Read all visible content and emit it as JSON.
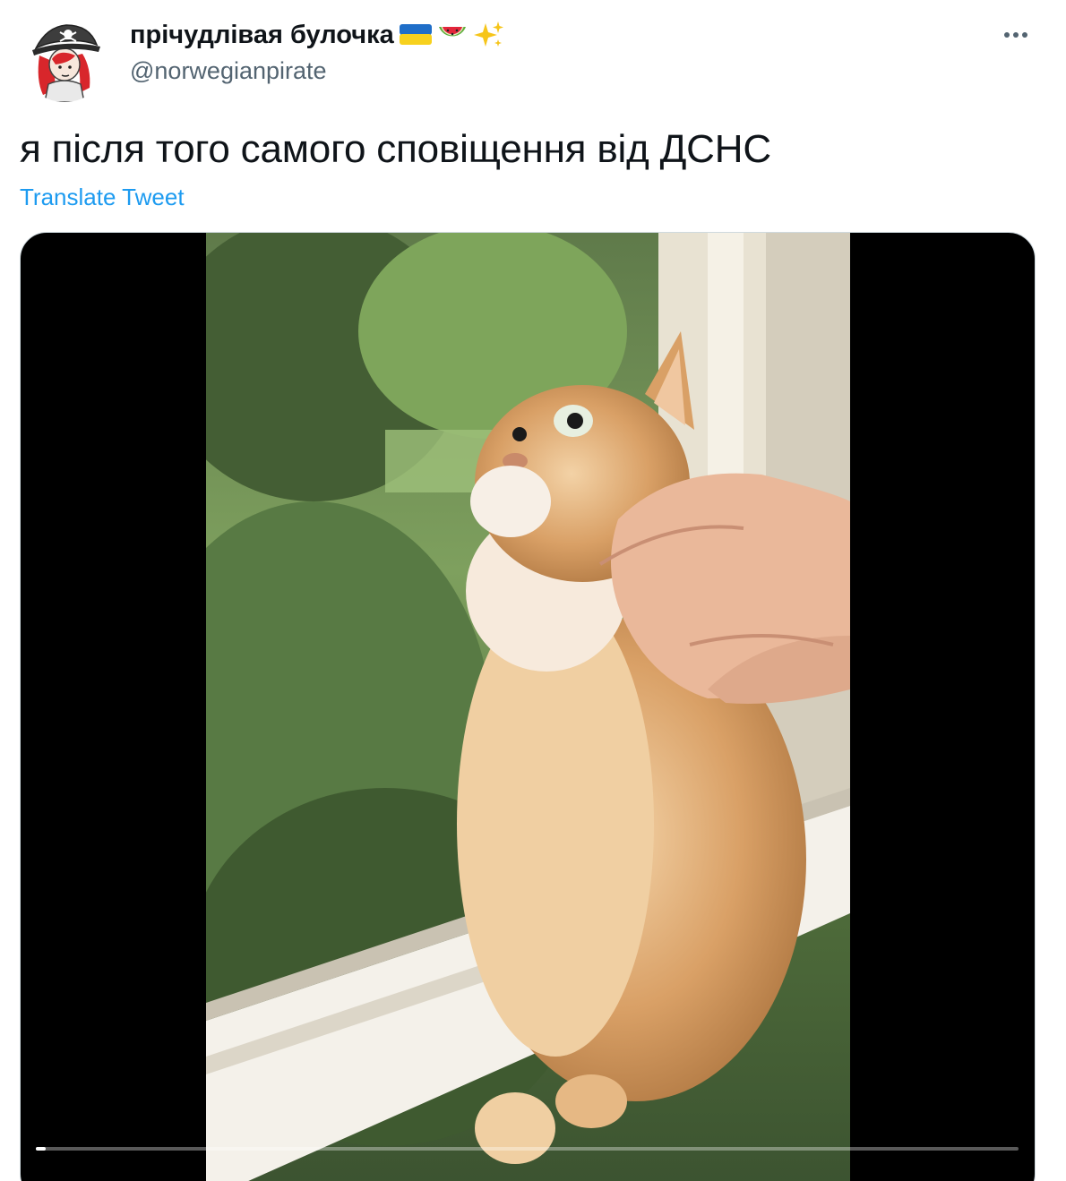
{
  "tweet": {
    "author": {
      "display_name": "прічудлівая булочка",
      "name_emojis": [
        "ukraine-flag-icon",
        "watermelon-icon",
        "sparkles-icon"
      ],
      "handle": "@norwegianpirate"
    },
    "more_icon": "more-dots-icon",
    "text": "я після того самого сповіщення від ДСНС",
    "translate_label": "Translate Tweet",
    "media": {
      "type": "video",
      "progress": 0.01
    }
  },
  "colors": {
    "text_primary": "#0f1419",
    "text_secondary": "#536471",
    "link": "#1d9bf0",
    "media_bg": "#000000"
  }
}
